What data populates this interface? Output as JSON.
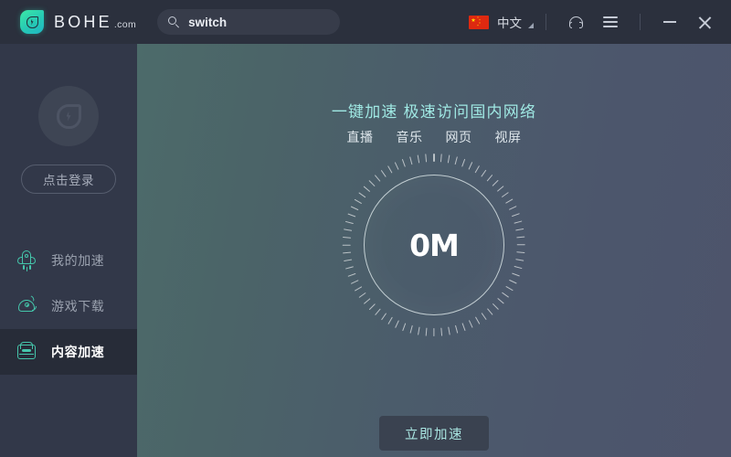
{
  "titlebar": {
    "logo_name": "BOHE",
    "logo_suffix": ".com",
    "search": {
      "value": "switch",
      "placeholder": "switch"
    },
    "language": "中文",
    "icons": {
      "flag": "china-flag-icon",
      "caret": "chevron-down-icon",
      "support": "headset-icon",
      "menu": "hamburger-menu-icon",
      "minimize": "minimize-icon",
      "close": "close-icon"
    }
  },
  "sidebar": {
    "avatar": "user-avatar-placeholder",
    "login_label": "点击登录",
    "items": [
      {
        "label": "我的加速",
        "icon": "rocket-icon",
        "active": false
      },
      {
        "label": "游戏下载",
        "icon": "alien-game-icon",
        "active": false
      },
      {
        "label": "内容加速",
        "icon": "inbox-icon",
        "active": true
      }
    ]
  },
  "main": {
    "title": "一键加速 极速访问国内网络",
    "tags": [
      "直播",
      "音乐",
      "网页",
      "视屏"
    ],
    "dial": {
      "value": "0M",
      "tick_count": 72
    },
    "accelerate_label": "立即加速"
  },
  "colors": {
    "accent_teal": "#45c6ab",
    "title_teal": "#9fe8e3",
    "sidebar_bg": "#323849",
    "titlebar_bg": "#2b303d",
    "active_item_bg": "#272c38",
    "button_bg": "#3a4250"
  }
}
